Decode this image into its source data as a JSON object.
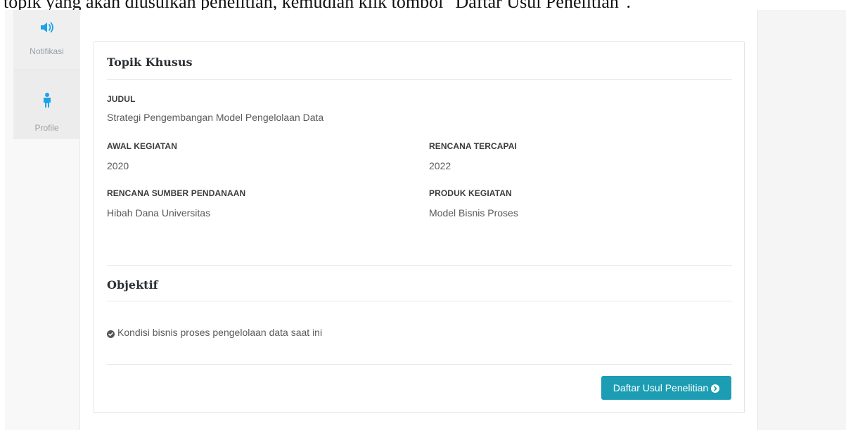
{
  "caption": "topik yang akan diusulkan penelitian, kemudian klik tombol \"Daftar Usul Penelitian\".",
  "sidebar": {
    "items": [
      {
        "label": "Notifikasi",
        "icon": "speaker-icon"
      },
      {
        "label": "Profile",
        "icon": "person-icon"
      }
    ]
  },
  "topik": {
    "title": "Topik Khusus",
    "judul_label": "JUDUL",
    "judul_value": "Strategi Pengembangan Model Pengelolaan Data",
    "awal_label": "AWAL KEGIATAN",
    "awal_value": "2020",
    "rencana_tercapai_label": "RENCANA TERCAPAI",
    "rencana_tercapai_value": "2022",
    "sumber_label": "RENCANA SUMBER PENDANAAN",
    "sumber_value": "Hibah Dana Universitas",
    "produk_label": "PRODUK KEGIATAN",
    "produk_value": "Model Bisnis Proses"
  },
  "objektif": {
    "title": "Objektif",
    "items": [
      "Kondisi bisnis proses pengelolaan data saat ini"
    ]
  },
  "actions": {
    "daftar_label": "Daftar Usul Penelitian"
  },
  "colors": {
    "accent": "#1c9db3",
    "icon_blue": "#1aa3e8"
  }
}
